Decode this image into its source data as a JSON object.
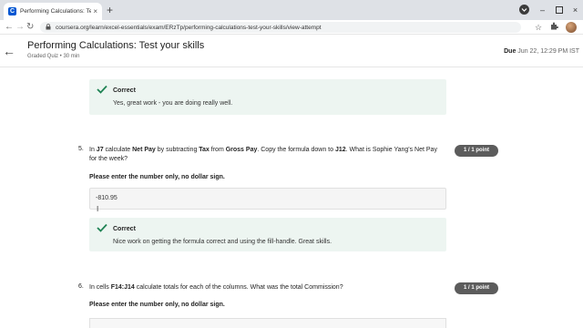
{
  "browser": {
    "tab_title": "Performing Calculations: Test you",
    "favicon_letter": "C",
    "tab_close": "×",
    "new_tab": "+",
    "url": "coursera.org/learn/excel-essentials/exam/ERzTp/performing-calculations-test-your-skills/view-attempt",
    "back_glyph": "←",
    "forward_glyph": "→",
    "reload_glyph": "↻",
    "lock_glyph": "🔒",
    "star_glyph": "☆",
    "menu_glyph": "⋮"
  },
  "header": {
    "back_glyph": "←",
    "title": "Performing Calculations: Test your skills",
    "subtitle": "Graded Quiz • 30 min",
    "due_label": "Due",
    "due_value": "Jun 22, 12:29 PM IST"
  },
  "feedback_top": {
    "heading": "Correct",
    "text": "Yes, great work - you are doing really well."
  },
  "q5": {
    "number": "5.",
    "text_1": "In ",
    "cell_1": "J7",
    "text_2": " calculate ",
    "term_1": "Net Pay",
    "text_3": " by subtracting ",
    "term_2": "Tax",
    "text_4": " from ",
    "term_3": "Gross Pay",
    "text_5": ". Copy the formula down to ",
    "cell_2": "J12",
    "text_6": ". What is Sophie Yang's Net Pay for the week?",
    "instruction": "Please enter the number only, no dollar sign.",
    "answer": "-810.95",
    "points": "1 / 1 point",
    "feedback_heading": "Correct",
    "feedback_text": "Nice work on getting the formula correct and using the fill-handle. Great skills."
  },
  "q6": {
    "number": "6.",
    "text_1": "In cells ",
    "cells": "F14:J14",
    "text_2": " calculate totals for each of the columns. What was the total Commission?",
    "instruction": "Please enter the number only, no dollar sign.",
    "points": "1 / 1 point"
  },
  "colors": {
    "brand": "#0056d2",
    "correct_green": "#1f8354",
    "feedback_bg": "#edf5f1",
    "badge_bg": "#5c5c5c"
  }
}
